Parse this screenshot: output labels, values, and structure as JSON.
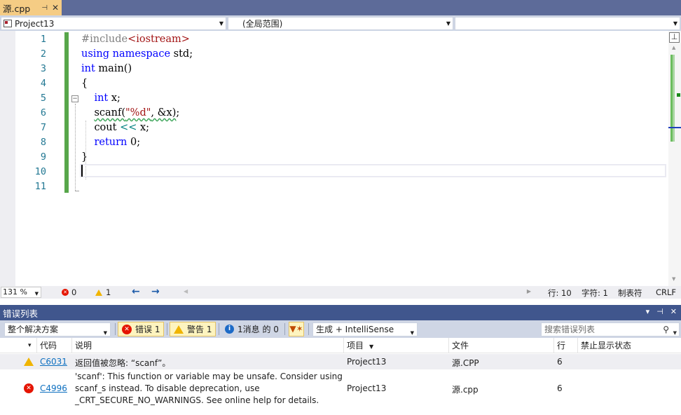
{
  "tab": {
    "label": "源.cpp",
    "pin": "⊣",
    "close": "✕"
  },
  "navbar": {
    "project": "Project13",
    "scope": "(全局范围)",
    "member": ""
  },
  "editor": {
    "line_numbers": [
      "1",
      "2",
      "3",
      "4",
      "5",
      "6",
      "7",
      "8",
      "9",
      "10",
      "11"
    ],
    "lines": [
      {
        "indent": "",
        "parts": [
          {
            "t": "#include",
            "c": "pp"
          },
          {
            "t": "<iostream>",
            "c": "str"
          }
        ]
      },
      {
        "indent": "",
        "parts": [
          {
            "t": "using",
            "c": "kw"
          },
          {
            "t": " ",
            "c": "normal"
          },
          {
            "t": "namespace",
            "c": "kw"
          },
          {
            "t": " std;",
            "c": "normal"
          }
        ]
      },
      {
        "indent": "",
        "parts": [
          {
            "t": "int",
            "c": "kw"
          },
          {
            "t": " main()",
            "c": "normal"
          }
        ]
      },
      {
        "indent": "",
        "parts": [
          {
            "t": "{",
            "c": "normal"
          }
        ]
      },
      {
        "indent": "    ",
        "parts": [
          {
            "t": "int",
            "c": "kw"
          },
          {
            "t": " x;",
            "c": "normal"
          }
        ]
      },
      {
        "indent": "    ",
        "parts": [
          {
            "t": "scanf(",
            "c": "normal squiggle"
          },
          {
            "t": "\"%d\"",
            "c": "str squiggle"
          },
          {
            "t": ", &x)",
            "c": "normal squiggle"
          },
          {
            "t": ";",
            "c": "normal"
          }
        ]
      },
      {
        "indent": "    ",
        "parts": [
          {
            "t": "cout ",
            "c": "normal"
          },
          {
            "t": "<<",
            "c": "op"
          },
          {
            "t": " x;",
            "c": "normal"
          }
        ]
      },
      {
        "indent": "    ",
        "parts": [
          {
            "t": "return",
            "c": "kw"
          },
          {
            "t": " 0;",
            "c": "normal"
          }
        ]
      },
      {
        "indent": "",
        "parts": [
          {
            "t": "}",
            "c": "normal"
          }
        ]
      },
      {
        "indent": "",
        "parts": []
      },
      {
        "indent": "",
        "parts": []
      }
    ],
    "collapse_glyph": "−",
    "split_glyph": "⊥"
  },
  "status_strip": {
    "zoom": "131 %",
    "errors": "0",
    "warnings": "1",
    "line": "行: 10",
    "char": "字符: 1",
    "tabs": "制表符",
    "eol": "CRLF"
  },
  "error_list": {
    "title": "错误列表",
    "scope_select": "整个解决方案",
    "errors_btn": "错误 1",
    "warnings_btn": "警告 1",
    "messages_btn": "1消息 的 0",
    "build_select": "生成 + IntelliSense",
    "search_placeholder": "搜索错误列表",
    "columns": {
      "code": "代码",
      "description": "说明",
      "project": "项目",
      "file": "文件",
      "line": "行",
      "suppression": "禁止显示状态"
    },
    "rows": [
      {
        "severity": "warning",
        "code": "C6031",
        "description": "返回值被忽略: “scanf”。",
        "project": "Project13",
        "file": "源.CPP",
        "line": "6",
        "suppression": ""
      },
      {
        "severity": "error",
        "code": "C4996",
        "description_lines": [
          "'scanf': This function or variable may be unsafe. Consider using",
          "scanf_s instead. To disable deprecation, use",
          "_CRT_SECURE_NO_WARNINGS. See online help for details."
        ],
        "project": "Project13",
        "file": "源.cpp",
        "line": "6",
        "suppression": ""
      }
    ]
  },
  "colors": {
    "tab_active": "#f5cc84",
    "title_bar": "#40568d",
    "keyword": "#0000ff",
    "string": "#a31515",
    "change_bar": "#57a64a",
    "error": "#e51400",
    "warning": "#f0b400",
    "link": "#0e70c0"
  },
  "icons": [
    "project-icon",
    "pin-icon",
    "close-icon",
    "split-icon",
    "error-icon",
    "warning-icon",
    "info-icon",
    "filter-icon",
    "search-icon",
    "chevron-down-icon",
    "arrow-left-icon",
    "arrow-right-icon",
    "sort-desc-icon"
  ]
}
